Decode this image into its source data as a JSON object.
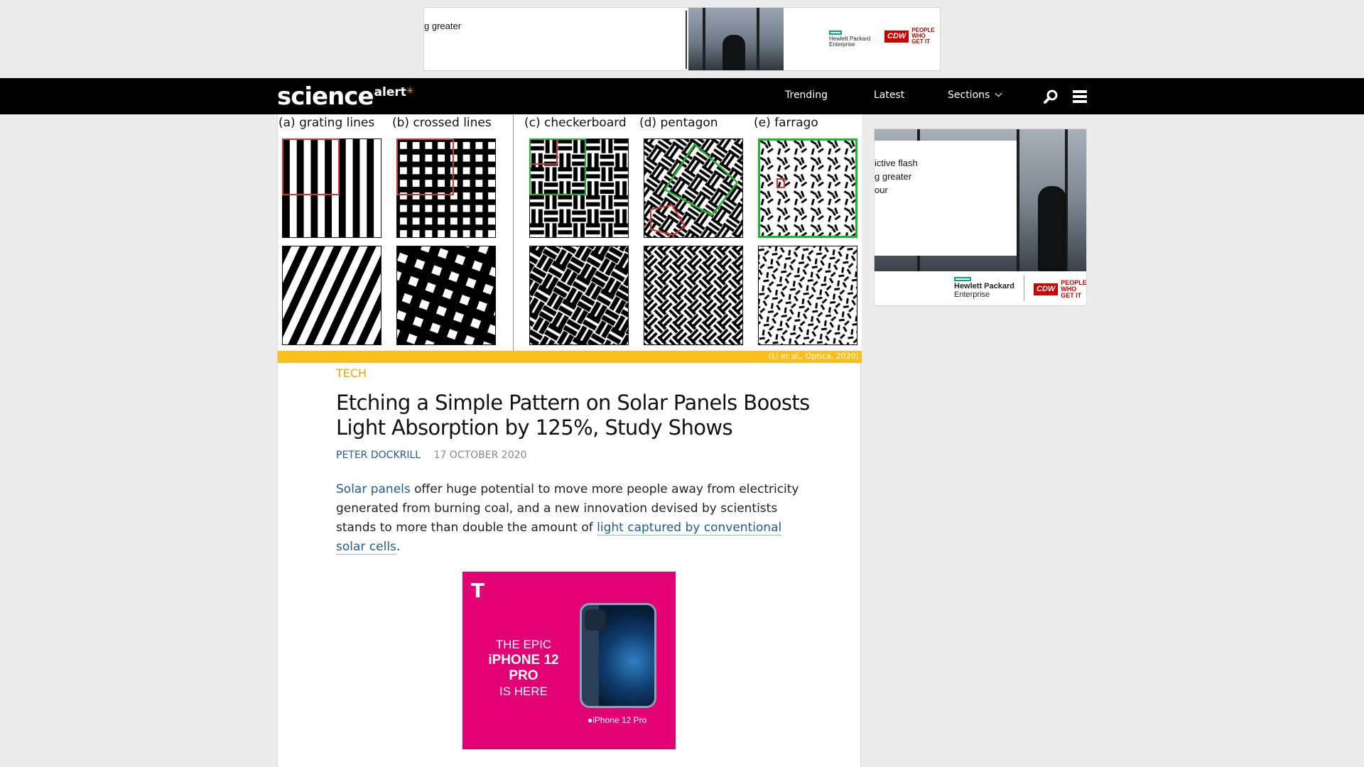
{
  "top_ad": {
    "text": "g greater",
    "hpe_line1": "Hewlett Packard",
    "hpe_line2": "Enterprise",
    "cdw_box": "CDW",
    "cdw_tag_1": "PEOPLE",
    "cdw_tag_2": "WHO",
    "cdw_tag_3": "GET IT"
  },
  "nav": {
    "logo_main": "science",
    "logo_sub": "alert",
    "links": [
      "Trending",
      "Latest",
      "Sections"
    ],
    "search_icon": "search-icon",
    "menu_icon": "hamburger-menu-icon"
  },
  "figure": {
    "labels": [
      "(a) grating lines",
      "(b) crossed lines",
      "(c) checkerboard",
      "(d) pentagon",
      "(e) farrago"
    ],
    "credit": "(Li et al., Optica, 2020)"
  },
  "article": {
    "category": "TECH",
    "headline": "Etching a Simple Pattern on Solar Panels Boosts Light Absorption by 125%, Study Shows",
    "author": "PETER DOCKRILL",
    "date": "17 OCTOBER 2020",
    "body_link1": "Solar panels",
    "body_text1": " offer huge potential to move more people away from electricity generated from burning coal, and a new innovation devised by scientists stands to more than double the amount of ",
    "body_link2": "light captured by conventional solar cells",
    "body_text2": "."
  },
  "inline_ad": {
    "brand_glyph": "T",
    "line1": "THE EPIC",
    "line2": "iPHONE 12 PRO",
    "line3": "IS HERE",
    "tag": "iPhone 12 Pro"
  },
  "side_ad": {
    "line1": "ictive flash",
    "line2": "g greater",
    "line3": "our",
    "hpe_line1": "Hewlett Packard",
    "hpe_line2": "Enterprise",
    "cdw_box": "CDW",
    "cdw_tag_1": "PEOPLE",
    "cdw_tag_2": "WHO",
    "cdw_tag_3": "GET IT"
  },
  "colors": {
    "accent_yellow": "#fcbf1c",
    "link_blue": "#1e5d99",
    "category_gold": "#e6a800",
    "tmobile_magenta": "#e20074",
    "highlight_red": "#d9342b",
    "highlight_green": "#1db82e"
  }
}
